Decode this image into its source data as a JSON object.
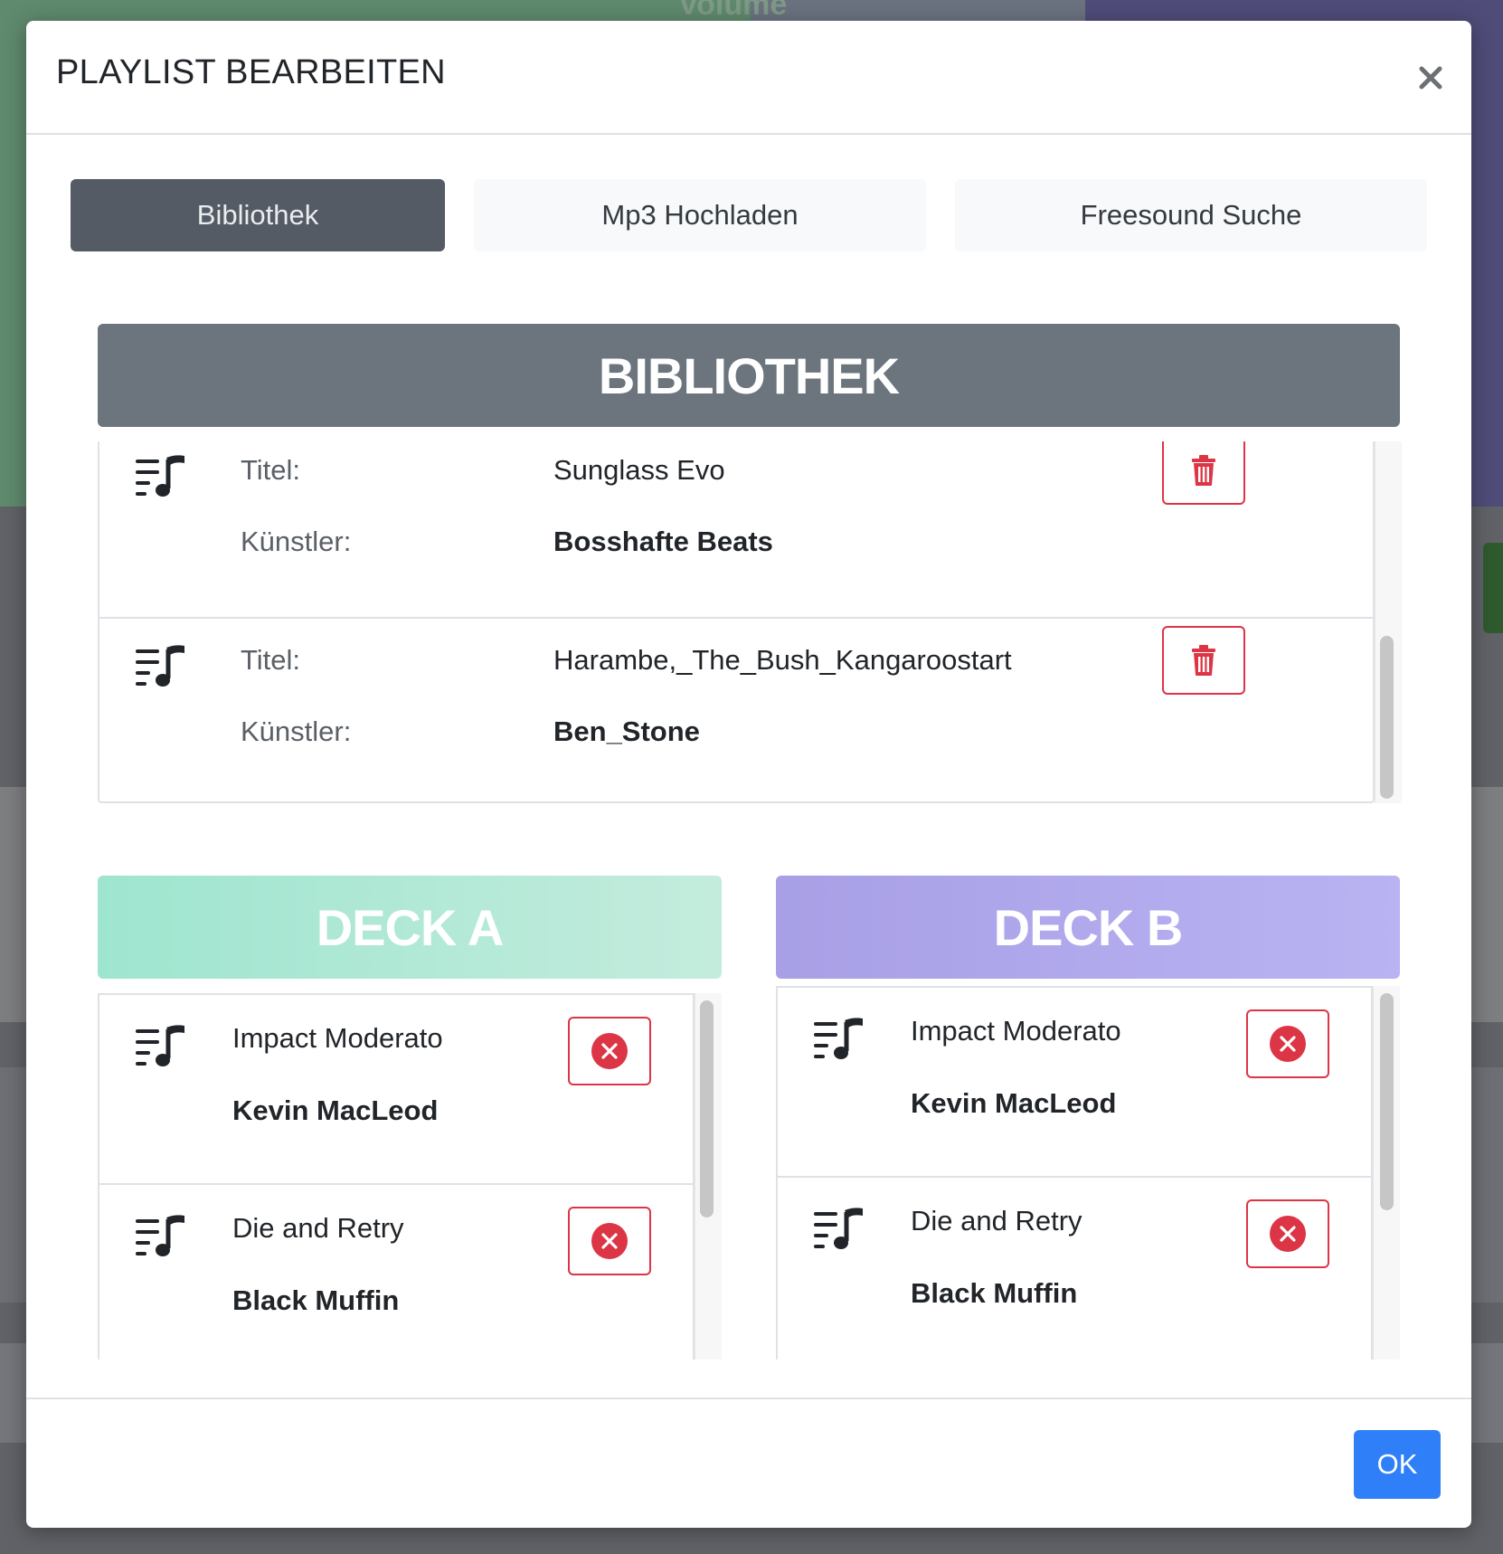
{
  "backdrop": {
    "partial_text": "Volume"
  },
  "modal": {
    "title": "PLAYLIST BEARBEITEN",
    "close_symbol": "×",
    "tabs": [
      {
        "label": "Bibliothek",
        "active": true
      },
      {
        "label": "Mp3 Hochladen",
        "active": false
      },
      {
        "label": "Freesound Suche",
        "active": false
      }
    ],
    "library": {
      "header": "BIBLIOTHEK",
      "title_label": "Titel:",
      "artist_label": "Künstler:",
      "items": [
        {
          "title": "Sunglass Evo",
          "artist": "Bosshafte Beats",
          "icon": "playlist-music-icon",
          "action_icon": "trash-icon"
        },
        {
          "title": "Harambe,_The_Bush_Kangaroostart",
          "artist": "Ben_Stone",
          "icon": "playlist-music-icon",
          "action_icon": "trash-icon"
        }
      ]
    },
    "deck_a": {
      "header": "DECK A",
      "items": [
        {
          "title": "Impact Moderato",
          "artist": "Kevin MacLeod",
          "icon": "playlist-music-icon",
          "action_icon": "remove-circle-icon"
        },
        {
          "title": "Die and Retry",
          "artist": "Black Muffin",
          "icon": "playlist-music-icon",
          "action_icon": "remove-circle-icon"
        }
      ]
    },
    "deck_b": {
      "header": "DECK B",
      "items": [
        {
          "title": "Impact Moderato",
          "artist": "Kevin MacLeod",
          "icon": "playlist-music-icon",
          "action_icon": "remove-circle-icon"
        },
        {
          "title": "Die and Retry",
          "artist": "Black Muffin",
          "icon": "playlist-music-icon",
          "action_icon": "remove-circle-icon"
        }
      ]
    },
    "footer": {
      "ok_label": "OK"
    }
  },
  "colors": {
    "library_header": "#6c757d",
    "deck_a_header": "#9ee5cf",
    "deck_b_header": "#a89fe6",
    "danger": "#dc3545",
    "primary": "#2f80f8",
    "active_tab": "#545b64"
  }
}
